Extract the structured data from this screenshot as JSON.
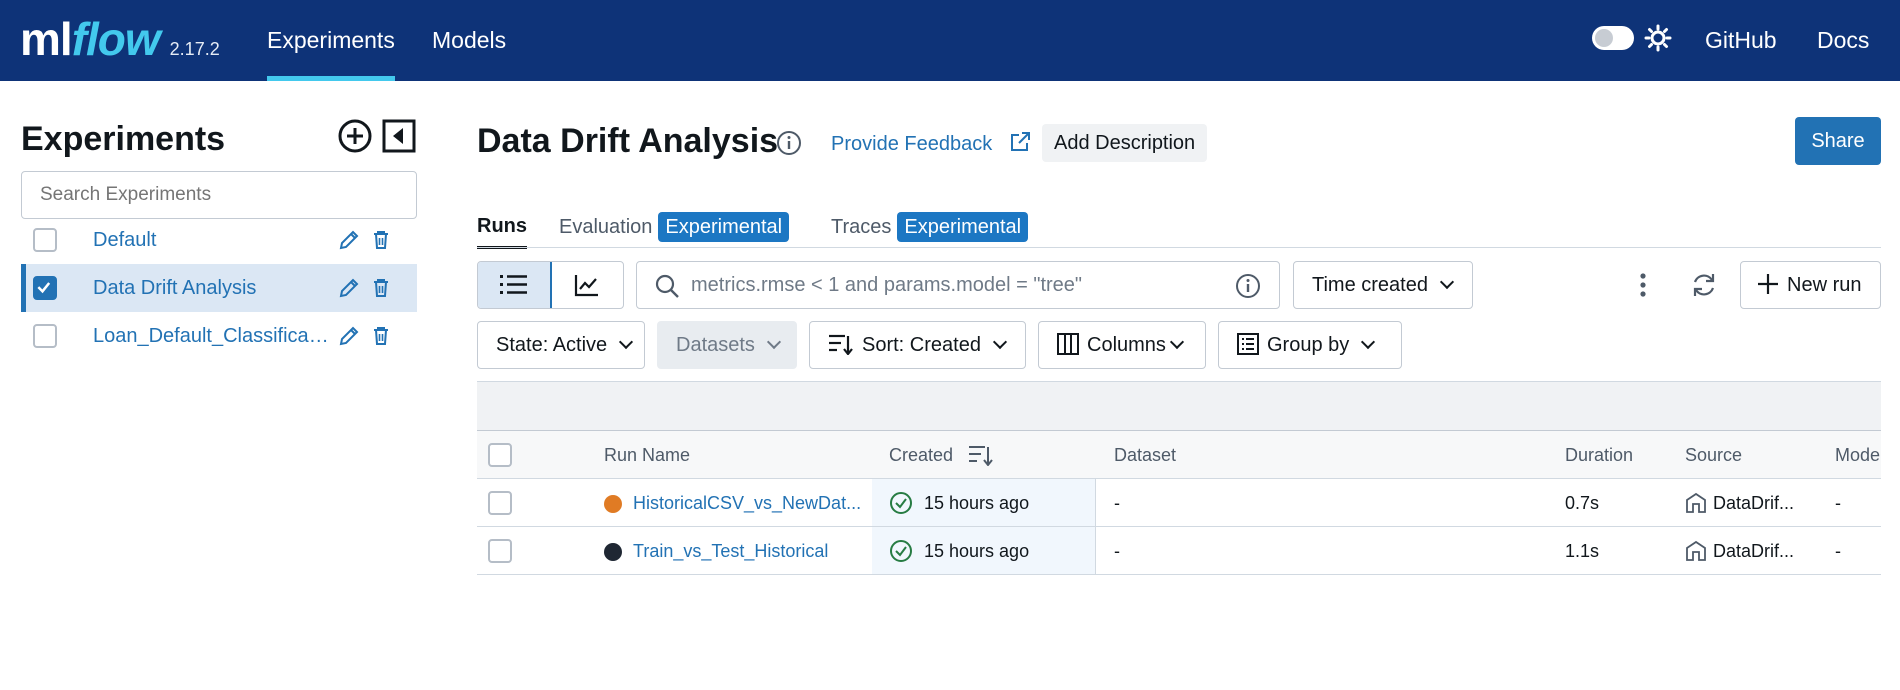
{
  "header": {
    "logo_ml": "ml",
    "logo_flow": "flow",
    "version": "2.17.2",
    "nav": [
      "Experiments",
      "Models"
    ],
    "links": [
      "GitHub",
      "Docs"
    ]
  },
  "sidebar": {
    "title": "Experiments",
    "search_placeholder": "Search Experiments",
    "experiments": [
      {
        "name": "Default",
        "checked": false
      },
      {
        "name": "Data Drift Analysis",
        "checked": true
      },
      {
        "name": "Loan_Default_Classificati...",
        "checked": false
      }
    ]
  },
  "main": {
    "title": "Data Drift Analysis",
    "feedback": "Provide Feedback",
    "add_description": "Add Description",
    "share": "Share",
    "tabs": [
      {
        "label": "Runs"
      },
      {
        "label": "Evaluation",
        "badge": "Experimental"
      },
      {
        "label": "Traces",
        "badge": "Experimental"
      }
    ],
    "search_placeholder": "metrics.rmse < 1 and params.model = \"tree\"",
    "time_select": "Time created",
    "new_run": "New run",
    "filters": {
      "state": "State: Active",
      "datasets": "Datasets",
      "sort": "Sort: Created",
      "columns": "Columns",
      "group_by": "Group by"
    }
  },
  "table": {
    "headers": [
      "Run Name",
      "Created",
      "Dataset",
      "Duration",
      "Source",
      "Mode"
    ],
    "rows": [
      {
        "name": "HistoricalCSV_vs_NewDat...",
        "color": "#e07b24",
        "created": "15 hours ago",
        "dataset": "-",
        "duration": "0.7s",
        "source": "DataDrif...",
        "model": "-"
      },
      {
        "name": "Train_vs_Test_Historical",
        "color": "#1f2733",
        "created": "15 hours ago",
        "dataset": "-",
        "duration": "1.1s",
        "source": "DataDrif...",
        "model": "-"
      }
    ]
  },
  "colors": {
    "header_bg": "#0e3378",
    "accent": "#2272b4",
    "logo_flow": "#43c9ed",
    "success": "#277c43"
  }
}
